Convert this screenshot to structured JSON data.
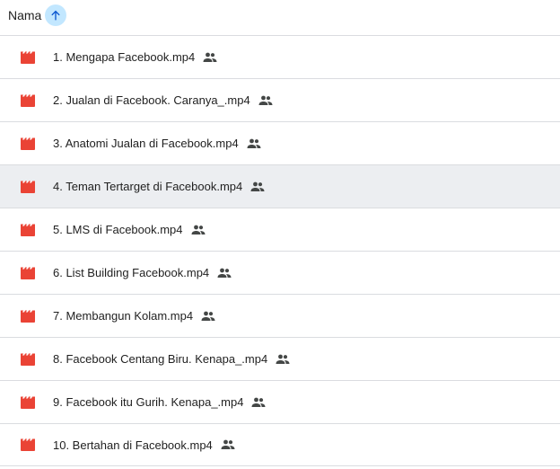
{
  "header": {
    "column_label": "Nama",
    "sort_direction": "ascending"
  },
  "colors": {
    "video_icon": "#ea4335",
    "sort_button_bg": "#c2e7ff",
    "selected_row_bg": "#eceef1",
    "divider": "#dadce0"
  },
  "files": [
    {
      "name": "1. Mengapa Facebook.mp4",
      "icon": "video-file-icon",
      "shared": true
    },
    {
      "name": "2. Jualan di Facebook. Caranya_.mp4",
      "icon": "video-file-icon",
      "shared": true
    },
    {
      "name": "3. Anatomi Jualan di Facebook.mp4",
      "icon": "video-file-icon",
      "shared": true
    },
    {
      "name": "4. Teman Tertarget di Facebook.mp4",
      "icon": "video-file-icon",
      "shared": true,
      "selected": true
    },
    {
      "name": "5. LMS di Facebook.mp4",
      "icon": "video-file-icon",
      "shared": true
    },
    {
      "name": "6. List Building Facebook.mp4",
      "icon": "video-file-icon",
      "shared": true
    },
    {
      "name": "7. Membangun Kolam.mp4",
      "icon": "video-file-icon",
      "shared": true
    },
    {
      "name": "8. Facebook Centang Biru. Kenapa_.mp4",
      "icon": "video-file-icon",
      "shared": true
    },
    {
      "name": "9. Facebook itu Gurih. Kenapa_.mp4",
      "icon": "video-file-icon",
      "shared": true
    },
    {
      "name": "10. Bertahan di Facebook.mp4",
      "icon": "video-file-icon",
      "shared": true
    }
  ]
}
